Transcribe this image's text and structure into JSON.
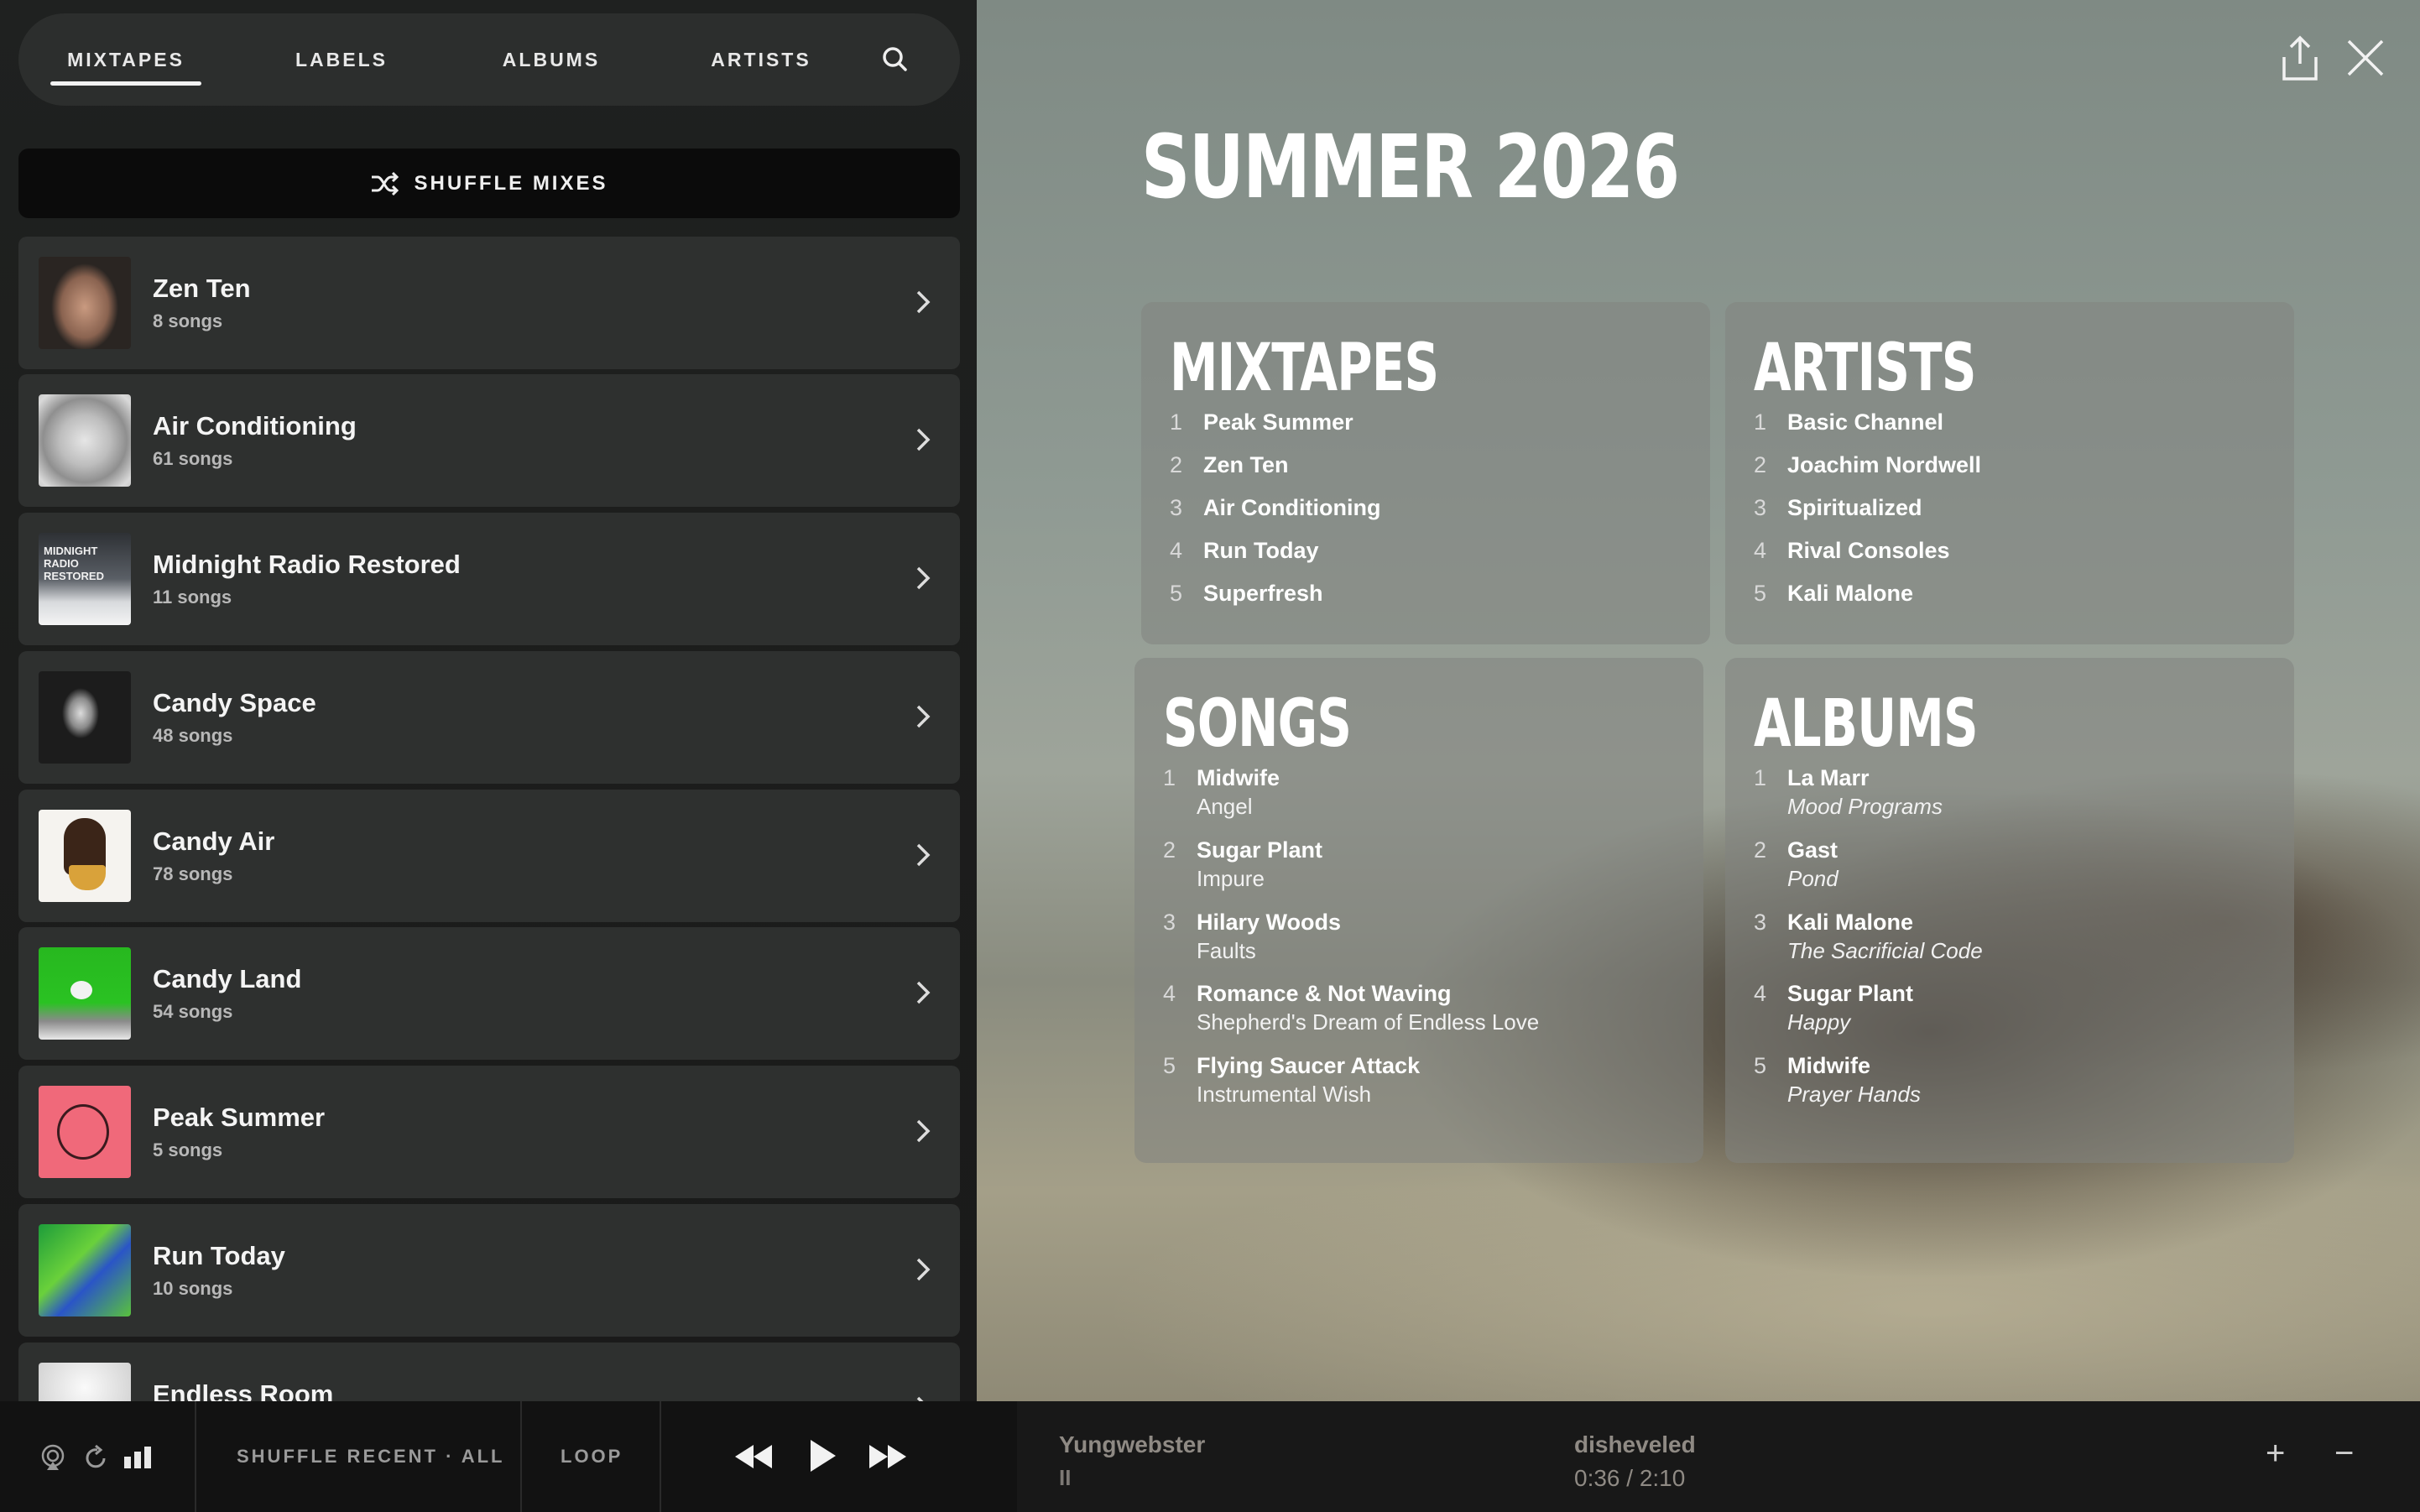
{
  "nav": {
    "tabs": [
      {
        "label": "MIXTAPES",
        "active": true
      },
      {
        "label": "LABELS",
        "active": false
      },
      {
        "label": "ALBUMS",
        "active": false
      },
      {
        "label": "ARTISTS",
        "active": false
      }
    ],
    "search_icon": "search-icon"
  },
  "shuffle_mixes": {
    "label": "SHUFFLE MIXES",
    "icon": "shuffle-icon"
  },
  "mixes": [
    {
      "title": "Zen Ten",
      "count": "8 songs"
    },
    {
      "title": "Air Conditioning",
      "count": "61 songs"
    },
    {
      "title": "Midnight Radio Restored",
      "count": "11 songs",
      "thumb_text": "MIDNIGHT RADIO RESTORED"
    },
    {
      "title": "Candy Space",
      "count": "48 songs"
    },
    {
      "title": "Candy Air",
      "count": "78 songs"
    },
    {
      "title": "Candy Land",
      "count": "54 songs"
    },
    {
      "title": "Peak Summer",
      "count": "5 songs"
    },
    {
      "title": "Run Today",
      "count": "10 songs"
    },
    {
      "title": "Endless Room",
      "count": ""
    }
  ],
  "page": {
    "title": "SUMMER 2026",
    "share_icon": "share-icon",
    "close_icon": "close-icon"
  },
  "cards": {
    "mixtapes": {
      "heading": "MIXTAPES",
      "items": [
        {
          "num": "1",
          "name": "Peak Summer"
        },
        {
          "num": "2",
          "name": "Zen Ten"
        },
        {
          "num": "3",
          "name": "Air Conditioning"
        },
        {
          "num": "4",
          "name": "Run Today"
        },
        {
          "num": "5",
          "name": "Superfresh"
        }
      ]
    },
    "artists": {
      "heading": "ARTISTS",
      "items": [
        {
          "num": "1",
          "name": "Basic Channel"
        },
        {
          "num": "2",
          "name": "Joachim Nordwell"
        },
        {
          "num": "3",
          "name": "Spiritualized"
        },
        {
          "num": "4",
          "name": "Rival Consoles"
        },
        {
          "num": "5",
          "name": "Kali Malone"
        }
      ]
    },
    "songs": {
      "heading": "SONGS",
      "items": [
        {
          "num": "1",
          "name": "Midwife",
          "sub": "Angel"
        },
        {
          "num": "2",
          "name": "Sugar Plant",
          "sub": "Impure"
        },
        {
          "num": "3",
          "name": "Hilary Woods",
          "sub": "Faults"
        },
        {
          "num": "4",
          "name": "Romance & Not Waving",
          "sub": "Shepherd's Dream of Endless Love"
        },
        {
          "num": "5",
          "name": "Flying Saucer Attack",
          "sub": "Instrumental Wish"
        }
      ]
    },
    "albums": {
      "heading": "ALBUMS",
      "items": [
        {
          "num": "1",
          "name": "La Marr",
          "sub": "Mood Programs"
        },
        {
          "num": "2",
          "name": "Gast",
          "sub": "Pond"
        },
        {
          "num": "3",
          "name": "Kali Malone",
          "sub": "The Sacrificial Code"
        },
        {
          "num": "4",
          "name": "Sugar Plant",
          "sub": "Happy"
        },
        {
          "num": "5",
          "name": "Midwife",
          "sub": "Prayer Hands"
        }
      ]
    }
  },
  "player": {
    "shuffle_label": "SHUFFLE RECENT · ALL",
    "loop_label": "LOOP",
    "artist": "Yungwebster",
    "state": "II",
    "track": "disheveled",
    "time": "0:36 / 2:10",
    "plus": "+",
    "minus": "−",
    "icons": [
      "airplay-icon",
      "repeat-icon",
      "bars-icon",
      "rewind-icon",
      "play-icon",
      "fast-forward-icon"
    ]
  }
}
